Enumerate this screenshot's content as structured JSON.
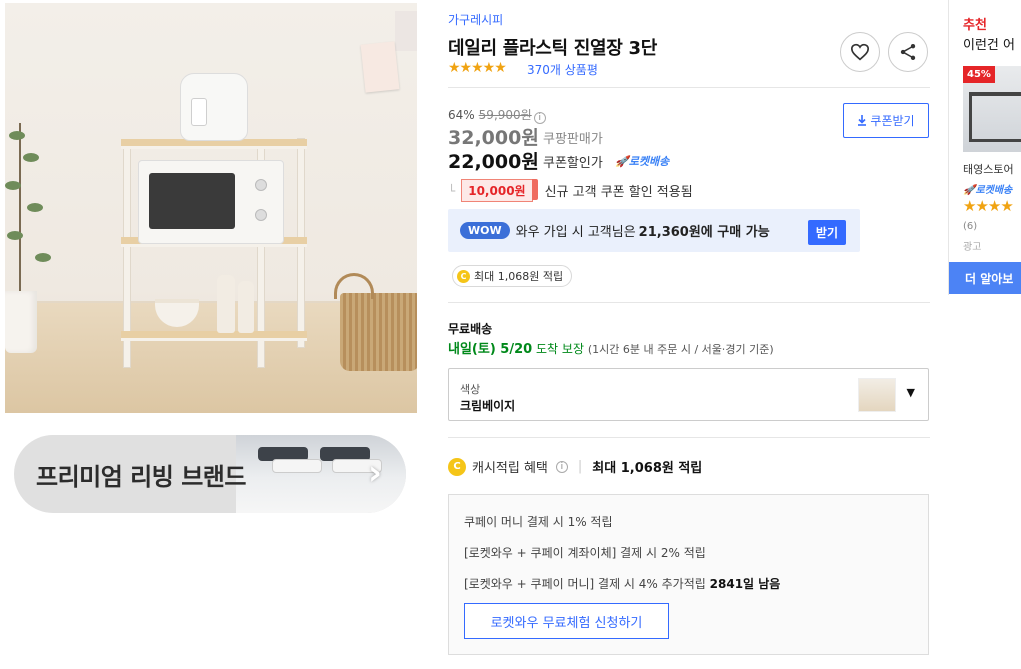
{
  "product": {
    "breadcrumb": "가구레시피",
    "title": "데일리 플라스틱 진열장 3단",
    "rating_stars": "★★★★★",
    "rating_value": 4.5,
    "review_count": "370개 상품평"
  },
  "price": {
    "discount_rate": "64%",
    "original_price": "59,900원",
    "sale_price": "32,000원",
    "sale_label": "쿠팡판매가",
    "coupon_price": "22,000원",
    "coupon_label": "쿠폰할인가",
    "rocket_label": "로켓배송",
    "coupon_button": "쿠폰받기"
  },
  "new_coupon": {
    "amount": "10,000원",
    "text": "신규 고객 쿠폰 할인 적용됨"
  },
  "wow": {
    "badge": "WOW",
    "text_before": "와우 가입 시 고객님은",
    "price": "21,360원에 구매 가능",
    "button": "받기"
  },
  "cash_pill": {
    "coin": "C",
    "text": "최대 1,068원 적립"
  },
  "shipping": {
    "label": "무료배송",
    "date": "내일(토) 5/20",
    "guarantee": "도착 보장",
    "detail": "(1시간 6분  내 주문 시 / 서울⋅경기 기준)"
  },
  "option": {
    "label": "색상",
    "value": "크림베이지",
    "caret": "▼"
  },
  "cashback": {
    "title": "캐시적립 혜택",
    "info": "i",
    "max": "최대 1,068원 적립",
    "lines": [
      "쿠페이 머니 결제 시 1% 적립",
      "[로켓와우 + 쿠페이 계좌이체] 결제 시 2% 적립",
      "[로켓와우 + 쿠페이 머니] 결제 시 4% 추가적립"
    ],
    "days_left": "2841일 남음",
    "trial_button": "로켓와우 무료체험 신청하기"
  },
  "banner": {
    "text": "프리미엄 리빙 브랜드",
    "arrow": "›"
  },
  "recommend": {
    "heading": "추천",
    "subheading": "이런건 어",
    "discount": "45%",
    "item_name": "태영스토어",
    "rocket": "로켓배송",
    "stars": "★★★★",
    "count": "(6)",
    "ad": "광고",
    "more_button": "더 알아보"
  },
  "colors": {
    "accent_blue": "#346aff",
    "star": "#f0a312",
    "coupon_red": "#e52528",
    "rocket_green": "#00891a"
  }
}
